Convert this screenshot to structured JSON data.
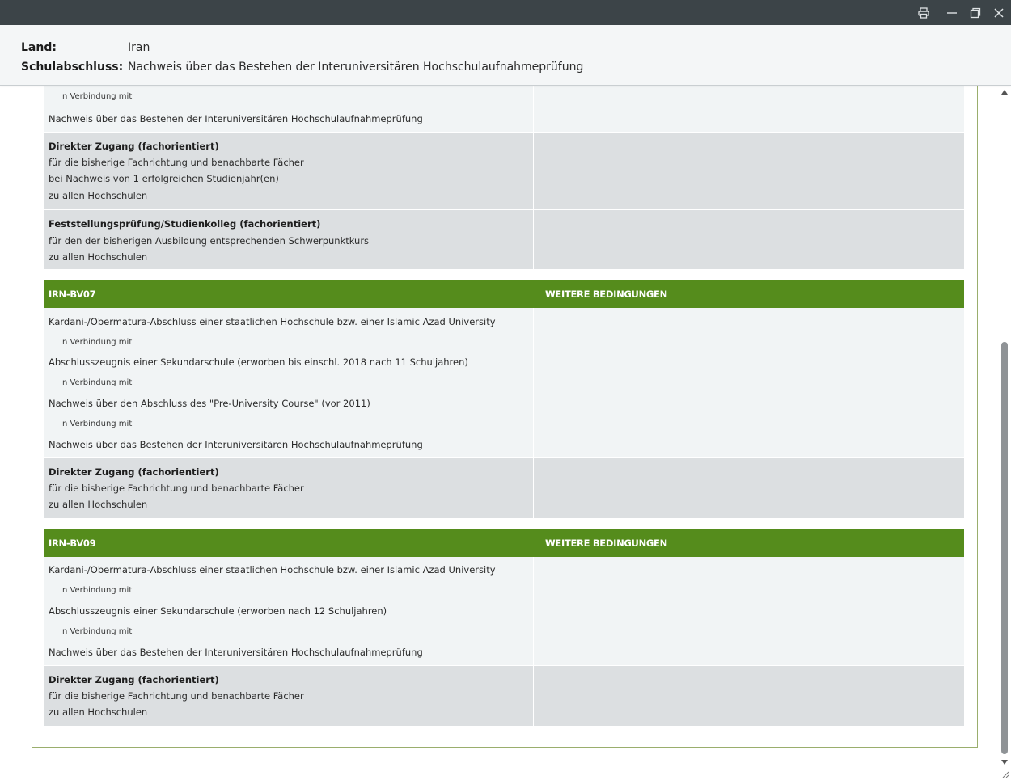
{
  "window": {
    "print_icon": "printer-icon",
    "minimize_icon": "minimize-icon",
    "restore_icon": "restore-icon",
    "close_icon": "close-icon"
  },
  "header": {
    "land_label": "Land:",
    "land_value": "Iran",
    "schul_label": "Schulabschluss:",
    "schul_value": "Nachweis über das Bestehen der Interuniversitären Hochschulaufnahmeprüfung"
  },
  "top_section": {
    "row1": {
      "conn": "In Verbindung mit",
      "line": "Nachweis über das Bestehen der Interuniversitären Hochschulaufnahmeprüfung"
    },
    "row2": {
      "title": "Direkter Zugang (fachorientiert)",
      "l1": "für die bisherige Fachrichtung und benachbarte Fächer",
      "l2": "bei Nachweis von 1 erfolgreichen Studienjahr(en)",
      "l3": "zu allen Hochschulen"
    },
    "row3": {
      "title": "Feststellungsprüfung/Studienkolleg (fachorientiert)",
      "l1": "für den der bisherigen Ausbildung entsprechenden Schwerpunktkurs",
      "l2": "zu allen Hochschulen"
    }
  },
  "bv07": {
    "code": "IRN-BV07",
    "conditions": "WEITERE BEDINGUNGEN",
    "l1": "Kardani-/Obermatura-Abschluss einer staatlichen Hochschule bzw. einer Islamic Azad University",
    "c1": "In Verbindung mit",
    "l2": "Abschlusszeugnis einer Sekundarschule (erworben bis einschl. 2018 nach 11 Schuljahren)",
    "c2": "In Verbindung mit",
    "l3": "Nachweis über den Abschluss des \"Pre-University Course\" (vor 2011)",
    "c3": "In Verbindung mit",
    "l4": "Nachweis über das Bestehen der Interuniversitären Hochschulaufnahmeprüfung",
    "access_title": "Direkter Zugang (fachorientiert)",
    "access_l1": "für die bisherige Fachrichtung und benachbarte Fächer",
    "access_l2": "zu allen Hochschulen"
  },
  "bv09": {
    "code": "IRN-BV09",
    "conditions": "WEITERE BEDINGUNGEN",
    "l1": "Kardani-/Obermatura-Abschluss einer staatlichen Hochschule bzw. einer Islamic Azad University",
    "c1": "In Verbindung mit",
    "l2": "Abschlusszeugnis einer Sekundarschule (erworben nach 12 Schuljahren)",
    "c2": "In Verbindung mit",
    "l3": "Nachweis über das Bestehen der Interuniversitären Hochschulaufnahmeprüfung",
    "access_title": "Direkter Zugang (fachorientiert)",
    "access_l1": "für die bisherige Fachrichtung und benachbarte Fächer",
    "access_l2": "zu allen Hochschulen"
  },
  "colors": {
    "accent_green": "#558c1c",
    "titlebar": "#3c4448"
  }
}
